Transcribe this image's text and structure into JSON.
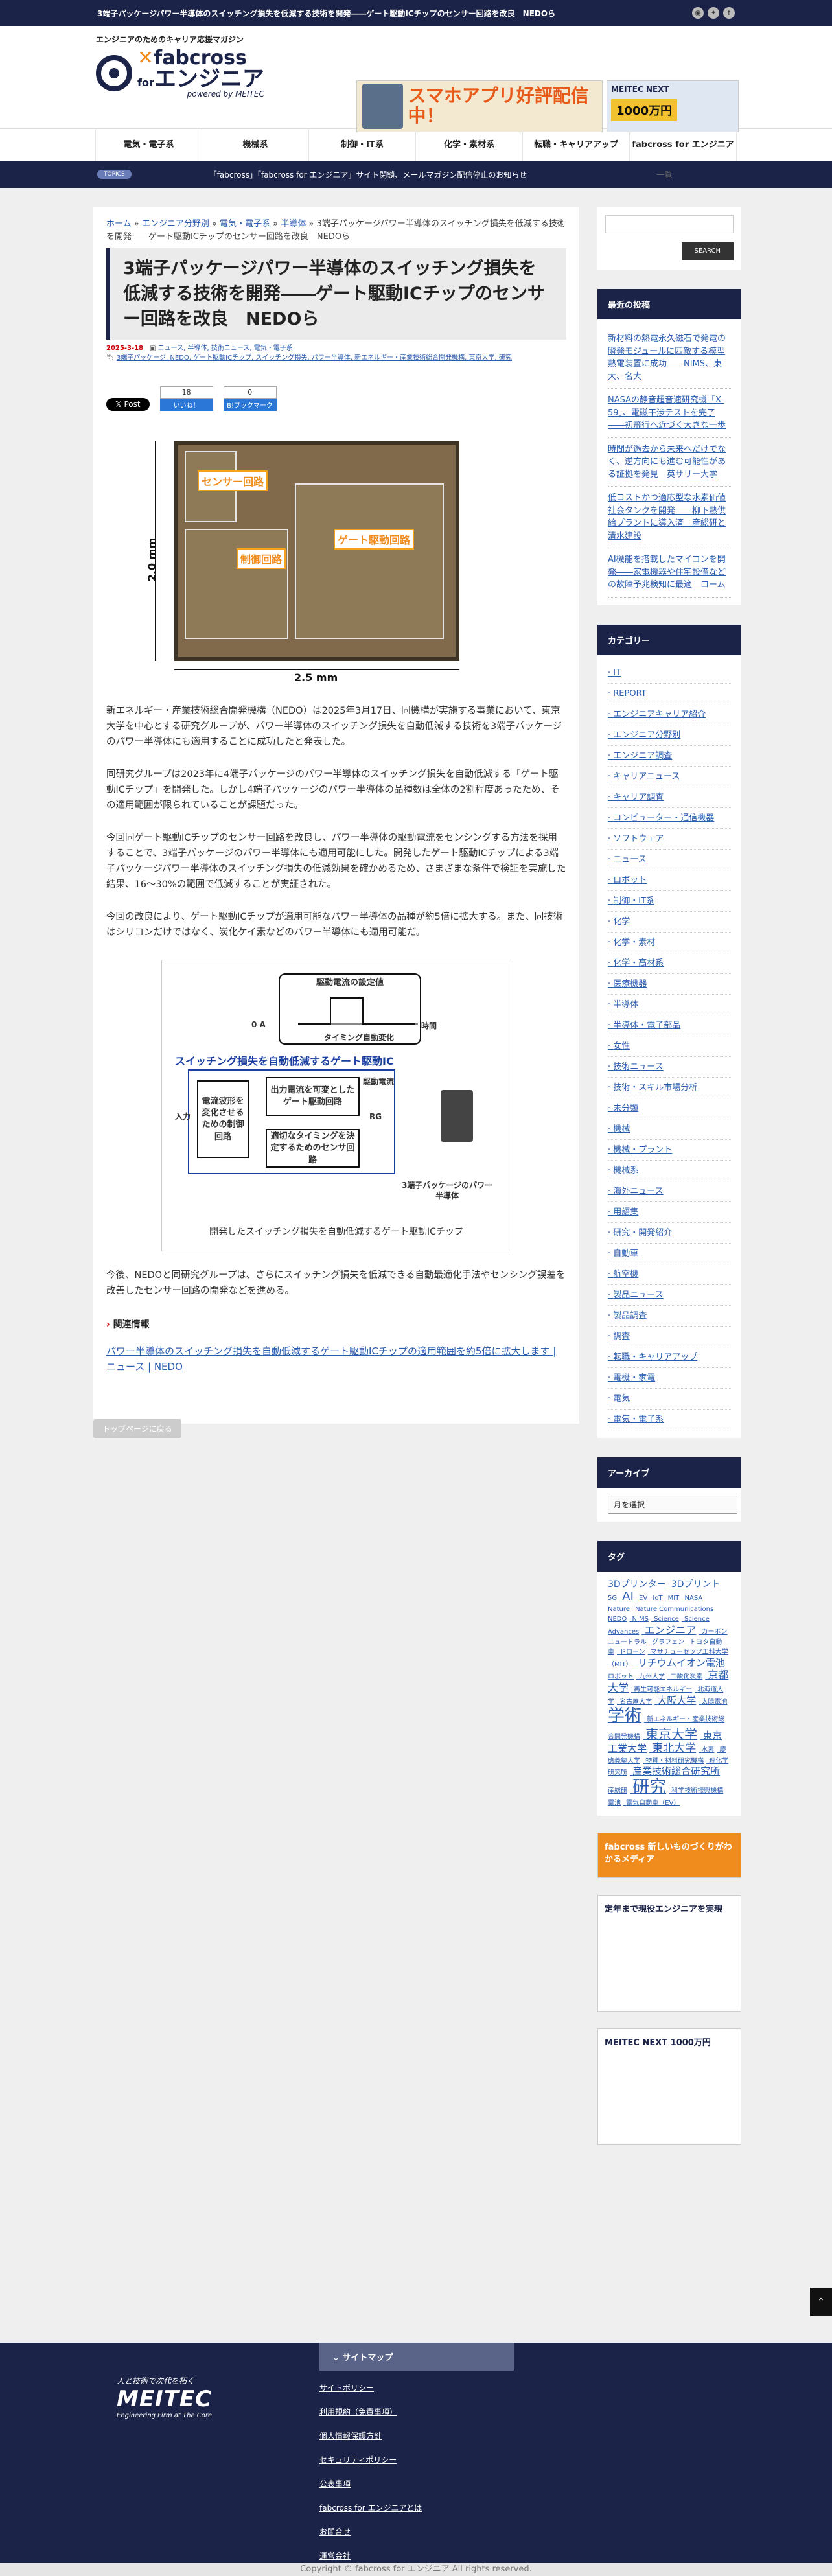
{
  "topbar": {
    "title": "3端子パッケージパワー半導体のスイッチング損失を低減する技術を開発――ゲート駆動ICチップのセンサー回路を改良　NEDOら"
  },
  "header": {
    "tagline": "エンジニアのためのキャリア応援マガジン",
    "logo_top": "fabcross",
    "logo_for": "for",
    "logo_eng": "エンジニア",
    "logo_pow": "powered by MEITEC",
    "banner1": "スマホアプリ好評配信中！",
    "banner2_a": "MEITEC NEXT",
    "banner2_b": "1000万円"
  },
  "nav": [
    "電気・電子系",
    "機械系",
    "制御・IT系",
    "化学・素材系",
    "転職・キャリアアップ",
    "fabcross for エンジニア"
  ],
  "news": {
    "tag": "TOPICS",
    "text": "「fabcross」「fabcross for エンジニア」サイト閉鎖、メールマガジン配信停止のお知らせ",
    "more": "一覧"
  },
  "crumb": {
    "home": "ホーム",
    "c1": "エンジニア分野別",
    "c2": "電気・電子系",
    "c3": "半導体",
    "rest": "3端子パッケージパワー半導体のスイッチング損失を低減する技術を開発――ゲート駆動ICチップのセンサー回路を改良　NEDOら"
  },
  "article": {
    "title": "3端子パッケージパワー半導体のスイッチング損失を低減する技術を開発――ゲート駆動ICチップのセンサー回路を改良　NEDOら",
    "date": "2025-3-18",
    "cats": "ニュース, 半導体, 技術ニュース, 電気・電子系",
    "tags": "3端子パッケージ, NEDO, ゲート駆動ICチップ, スイッチング損失, パワー半導体, 新エネルギー・産業技術総合開発機構, 東京大学, 研究",
    "x_post": "Post",
    "like_count": "18",
    "like": "いいね！",
    "hb_count": "0",
    "hb": "B!ブックマーク",
    "fig1": {
      "sensor": "センサー回路",
      "control": "制御回路",
      "gate": "ゲート駆動回路",
      "h": "2.0 mm",
      "w": "2.5 mm"
    },
    "p1": "新エネルギー・産業技術総合開発機構（NEDO）は2025年3月17日、同機構が実施する事業において、東京大学を中心とする研究グループが、パワー半導体のスイッチング損失を自動低減する技術を3端子パッケージのパワー半導体にも適用することに成功したと発表した。",
    "p2": "同研究グループは2023年に4端子パッケージのパワー半導体のスイッチング損失を自動低減する「ゲート駆動ICチップ」を開発した。しかし4端子パッケージのパワー半導体の品種数は全体の2割程度あったため、その適用範囲が限られていることが課題だった。",
    "p3": "今回同ゲート駆動ICチップのセンサー回路を改良し、パワー半導体の駆動電流をセンシングする方法を採用することで、3端子パッケージのパワー半導体にも適用可能にした。開発したゲート駆動ICチップによる3端子パッケージパワー半導体のスイッチング損失の低減効果を確かめるため、さまざまな条件で検証を実施した結果、16～30%の範囲で低減することが実証された。",
    "p4": "今回の改良により、ゲート駆動ICチップが適用可能なパワー半導体の品種が約5倍に拡大する。また、同技術はシリコンだけではなく、炭化ケイ素などのパワー半導体にも適用可能だ。",
    "fig2": {
      "setting": "駆動電流の設定値",
      "zero": "0 A",
      "time": "時間",
      "timing": "タイミング自動変化",
      "title": "スイッチング損失を自動低減するゲート駆動IC",
      "input": "入力",
      "ctrl": "電流波形を変化させるための制御回路",
      "out": "出力電流を可変としたゲート駆動回路",
      "sensor": "適切なタイミングを決定するためのセンサ回路",
      "drive": "駆動電流",
      "rg": "RG",
      "pkg": "3端子パッケージのパワー半導体",
      "caption": "開発したスイッチング損失を自動低減するゲート駆動ICチップ"
    },
    "p5": "今後、NEDOと同研究グループは、さらにスイッチング損失を低減できる自動最適化手法やセンシング誤差を改善したセンサー回路の開発などを進める。",
    "related_h": "関連情報",
    "related": "パワー半導体のスイッチング損失を自動低減するゲート駆動ICチップの適用範囲を約5倍に拡大します | ニュース | NEDO",
    "back": "トップページに戻る"
  },
  "side": {
    "search_btn": "SEARCH",
    "recent_h": "最近の投稿",
    "recent": [
      "新材料の熱電永久磁石で発電の瞬発モジュールに匹敵する模型熱電装置に成功――NIMS、東大、名大",
      "NASAの静音超音速研究機「X-59」、電磁干渉テストを完了――初飛行へ近づく大きな一歩",
      "時間が過去から未来へだけでなく、逆方向にも進む可能性がある証拠を発見　英サリー大学",
      "低コストかつ適応型な水素価値社会タンクを開発――柳下熱供給プラントに導入済　産総研と清水建設",
      "AI機能を搭載したマイコンを開発――家電機器や住宅設備などの故障予兆検知に最適　ローム"
    ],
    "cats_h": "カテゴリー",
    "cats": [
      "IT",
      "REPORT",
      "エンジニアキャリア紹介",
      "エンジニア分野別",
      "エンジニア調査",
      "キャリアニュース",
      "キャリア調査",
      "コンピューター・通信機器",
      "ソフトウェア",
      "ニュース",
      "ロボット",
      "制御・IT系",
      "化学",
      "化学・素材",
      "化学・高材系",
      "医療機器",
      "半導体",
      "半導体・電子部品",
      "女性",
      "技術ニュース",
      "技術・スキル市場分析",
      "未分類",
      "機械",
      "機械・プラント",
      "機械系",
      "海外ニュース",
      "用語集",
      "研究・開発紹介",
      "自動車",
      "航空機",
      "製品ニュース",
      "製品調査",
      "調査",
      "転職・キャリアアップ",
      "電機・家電",
      "電気",
      "電気・電子系"
    ],
    "arch_h": "アーカイブ",
    "arch_sel": "月を選択",
    "tag_h": "タグ",
    "tags": [
      "3Dプリンター",
      "3Dプリント",
      "5G",
      "AI",
      "EV",
      "IoT",
      "MIT",
      "NASA",
      "Nature",
      "Nature Communications",
      "NEDO",
      "NIMS",
      "Science",
      "Science Advances",
      "エンジニア",
      "カーボンニュートラル",
      "グラフェン",
      "トヨタ自動車",
      "ドローン",
      "マサチューセッツ工科大学（MIT）",
      "リチウムイオン電池",
      "ロボット",
      "九州大学",
      "二酸化炭素",
      "京都大学",
      "再生可能エネルギー",
      "北海道大学",
      "名古屋大学",
      "大阪大学",
      "太陽電池",
      "学術",
      "新エネルギー・産業技術総合開発機構",
      "東京大学",
      "東京工業大学",
      "東北大学",
      "水素",
      "慶應義塾大学",
      "物質・材料研究機構",
      "理化学研究所",
      "産業技術総合研究所",
      "産総研",
      "研究",
      "科学技術振興機構",
      "電池",
      "電気自動車（EV）"
    ],
    "sb1": "fabcross 新しいものづくりがわかるメディア",
    "sb2": "定年まで現役エンジニアを実現",
    "sb3": "MEITEC NEXT 1000万円"
  },
  "footer": {
    "slogan": "人と技術で次代を拓く",
    "brand": "MEITEC",
    "en": "Engineering Firm at The Core",
    "sm_h": "サイトマップ",
    "sm": [
      "サイトポリシー",
      "利用規約（免責事項）",
      "個人情報保護方針",
      "セキュリティポリシー",
      "公表事項",
      "fabcross for エンジニアとは",
      "お問合せ",
      "運営会社"
    ],
    "copy": "Copyright ©  fabcross for エンジニア All rights reserved."
  }
}
